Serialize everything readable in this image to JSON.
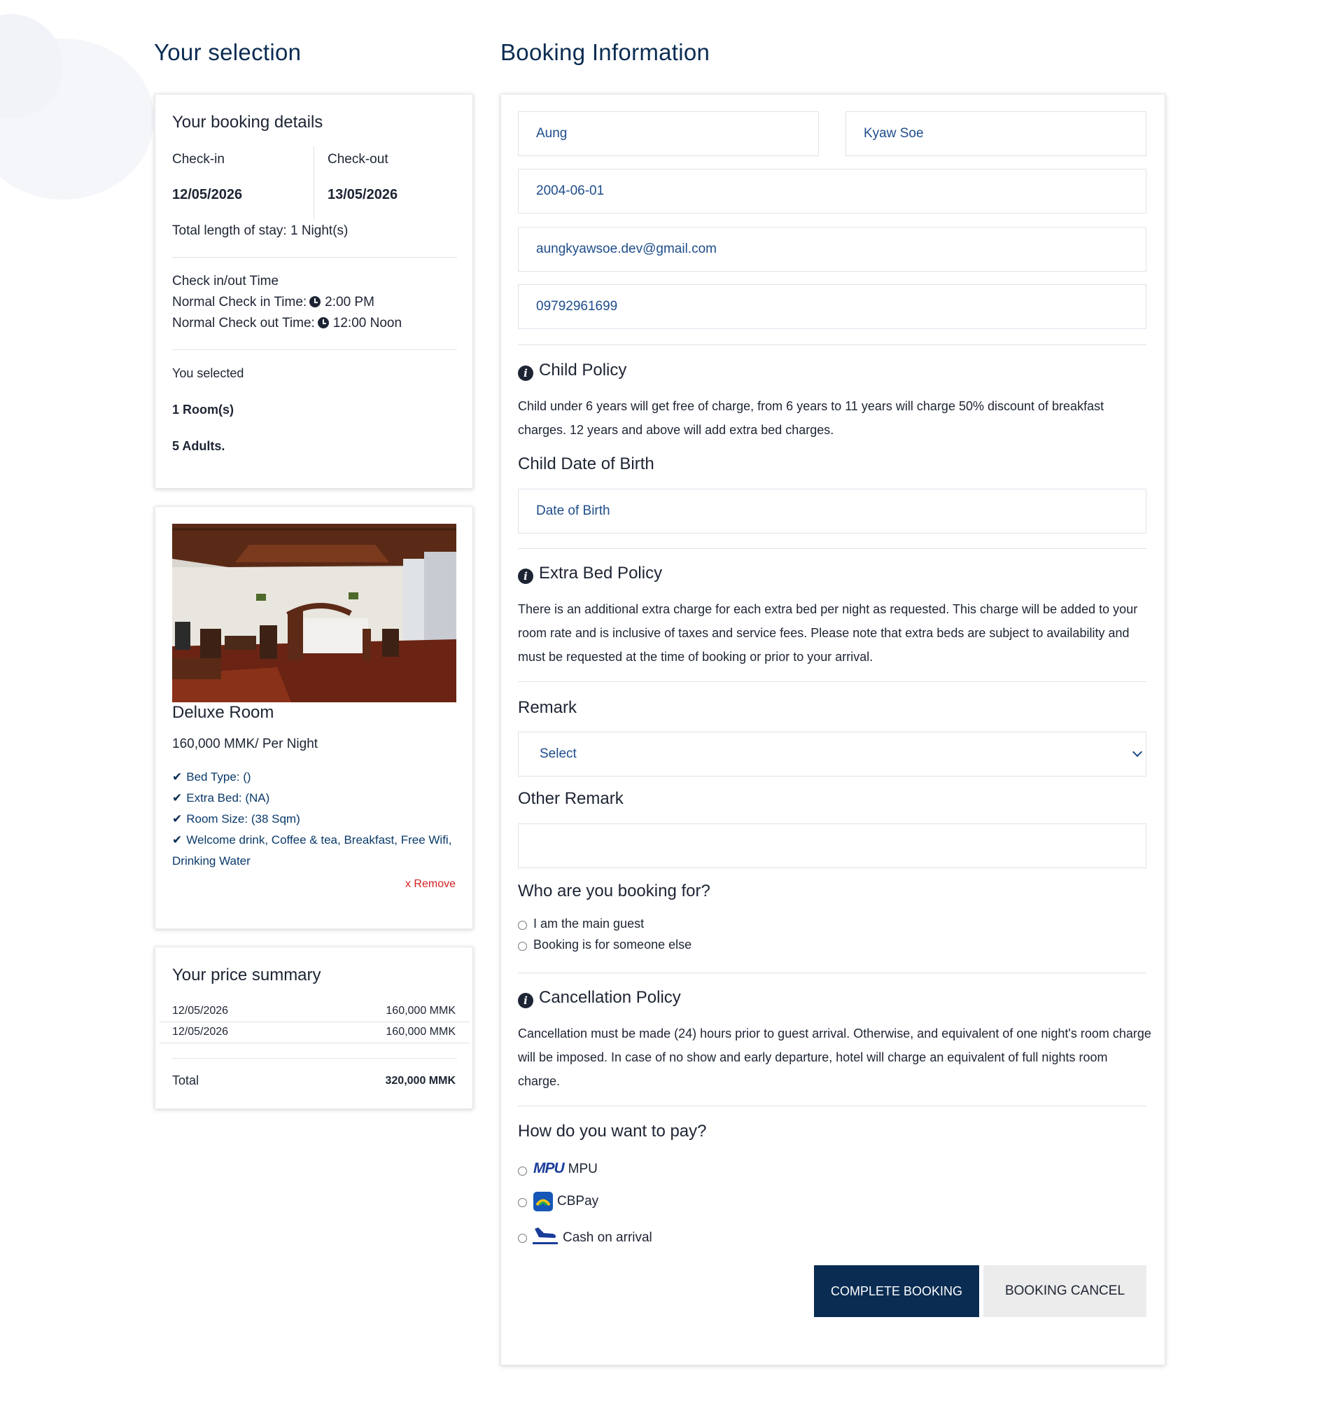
{
  "selection": {
    "title": "Your selection",
    "booking_details": {
      "heading": "Your booking details",
      "checkin_label": "Check-in",
      "checkout_label": "Check-out",
      "checkin_date": "12/05/2026",
      "checkout_date": "13/05/2026",
      "length_of_stay": "Total length of stay: 1 Night(s)",
      "time_heading": "Check in/out Time",
      "normal_checkin_label": "Normal Check in Time:",
      "normal_checkin_value": "2:00 PM",
      "normal_checkout_label": "Normal Check out Time:",
      "normal_checkout_value": "12:00 Noon",
      "selected_heading": "You selected",
      "rooms": "1 Room(s)",
      "adults": "5 Adults."
    },
    "room": {
      "name": "Deluxe Room",
      "price": "160,000 MMK/ Per Night",
      "features": [
        "Bed Type: ()",
        "Extra Bed: (NA)",
        "Room Size: (38 Sqm)",
        "Welcome drink, Coffee & tea, Breakfast, Free Wifi,",
        "Drinking Water"
      ],
      "remove_label": "x Remove"
    },
    "price_summary": {
      "heading": "Your price summary",
      "rows": [
        {
          "date": "12/05/2026",
          "amount": "160,000 MMK"
        },
        {
          "date": "12/05/2026",
          "amount": "160,000 MMK"
        }
      ],
      "total_label": "Total",
      "total_value": "320,000 MMK"
    }
  },
  "booking": {
    "title": "Booking Information",
    "first_name": "Aung",
    "last_name": "Kyaw Soe",
    "dob": "2004-06-01",
    "email": "aungkyawsoe.dev@gmail.com",
    "phone": "09792961699",
    "child_policy": {
      "heading": "Child Policy",
      "text": "Child under 6 years will get free of charge, from 6 years to 11 years will charge 50% discount of breakfast charges. 12 years and above will add extra bed charges."
    },
    "child_dob_heading": "Child Date of Birth",
    "child_dob_placeholder": "Date of Birth",
    "extra_bed_policy": {
      "heading": "Extra Bed Policy",
      "text": "There is an additional extra charge for each extra bed per night as requested. This charge will be added to your room rate and is inclusive of taxes and service fees. Please note that extra beds are subject to availability and must be requested at the time of booking or prior to your arrival."
    },
    "remark_heading": "Remark",
    "remark_selected": "Select",
    "other_remark_heading": "Other Remark",
    "who_heading": "Who are you booking for?",
    "who_options": [
      "I am the main guest",
      "Booking is for someone else"
    ],
    "cancellation_policy": {
      "heading": "Cancellation Policy",
      "text": "Cancellation must be made (24) hours prior to guest arrival. Otherwise, and equivalent of one night's room charge will be imposed. In case of no show and early departure, hotel will charge an equivalent of full nights room charge."
    },
    "pay_heading": "How do you want to pay?",
    "pay_options": [
      {
        "label": "MPU",
        "logo_text": "MPU"
      },
      {
        "label": "CBPay"
      },
      {
        "label": "Cash on arrival"
      }
    ],
    "complete_button": "COMPLETE BOOKING",
    "cancel_button": "BOOKING CANCEL"
  },
  "colors": {
    "navy": "#0a2c52",
    "field_text": "#1e4d8c",
    "remove": "#d21f1f",
    "cancel_bg": "#ececec"
  },
  "icons": [
    "clock-icon",
    "info-icon",
    "check-icon",
    "chevron-down-icon",
    "mpu-logo",
    "cbpay-logo",
    "plane-icon"
  ]
}
